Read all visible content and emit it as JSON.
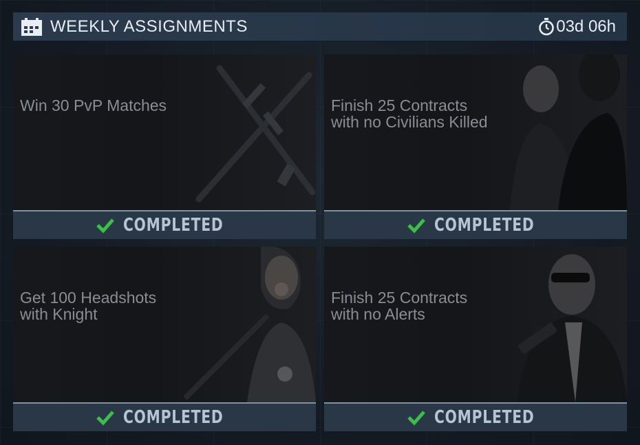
{
  "header": {
    "title": "WEEKLY ASSIGNMENTS",
    "timer": "03d 06h",
    "icons": [
      "calendar-icon",
      "stopwatch-icon"
    ]
  },
  "assignments": [
    {
      "title": "Win 30 PvP Matches",
      "status": "COMPLETED",
      "art": "rifles"
    },
    {
      "title": "Finish 25 Contracts\nwith no Civilians Killed",
      "status": "COMPLETED",
      "art": "agents"
    },
    {
      "title": "Get 100 Headshots\nwith Knight",
      "status": "COMPLETED",
      "art": "knight"
    },
    {
      "title": "Finish 25 Contracts\nwith no Alerts",
      "status": "COMPLETED",
      "art": "hitman"
    }
  ],
  "colors": {
    "header_bg": "#2b3a4c",
    "status_bg": "#2a3746",
    "check_green": "#3cbf4a",
    "status_text": "#b7c4d2"
  }
}
